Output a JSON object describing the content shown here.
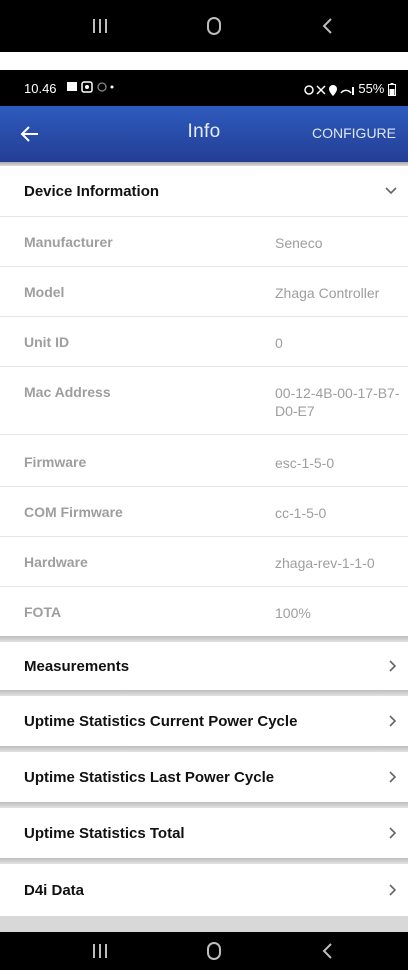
{
  "app": {
    "title": "Info",
    "configure_label": "CONFIGURE"
  },
  "status_bar": {
    "time": "10.46",
    "battery": "55%"
  },
  "device_information": {
    "header": "Device Information",
    "rows": [
      {
        "label": "Manufacturer",
        "value": "Seneco"
      },
      {
        "label": "Model",
        "value": "Zhaga Controller"
      },
      {
        "label": "Unit ID",
        "value": "0"
      },
      {
        "label": "Mac Address",
        "value": "00-12-4B-00-17-B7-D0-E7"
      },
      {
        "label": "Firmware",
        "value": "esc-1-5-0"
      },
      {
        "label": "COM Firmware",
        "value": "cc-1-5-0"
      },
      {
        "label": "Hardware",
        "value": "zhaga-rev-1-1-0"
      },
      {
        "label": "FOTA",
        "value": "100%"
      }
    ]
  },
  "sections": [
    {
      "label": "Measurements"
    },
    {
      "label": "Uptime Statistics Current Power Cycle"
    },
    {
      "label": "Uptime Statistics Last Power Cycle"
    },
    {
      "label": "Uptime Statistics Total"
    },
    {
      "label": "D4i Data"
    }
  ],
  "icons": {
    "back": "arrow-left-icon",
    "expanded": "chevron-down-icon",
    "collapsed": "chevron-right-icon"
  },
  "colors": {
    "app_bar": "#2d5bbd",
    "secondary_text": "#9e9e9e"
  }
}
